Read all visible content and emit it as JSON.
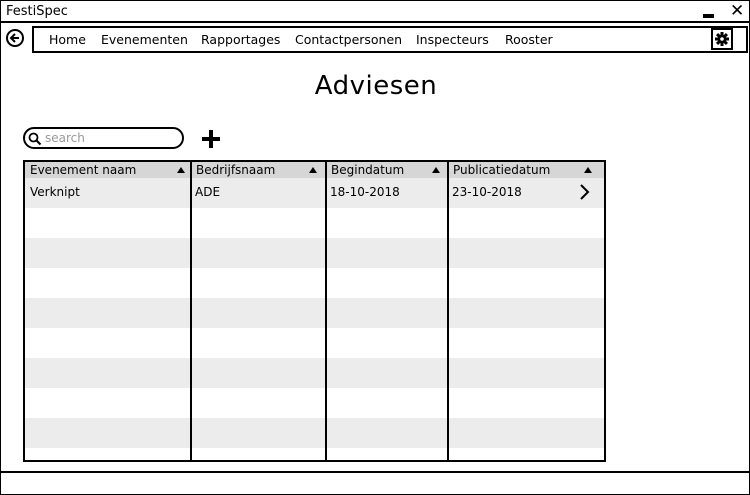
{
  "window": {
    "title": "FestiSpec",
    "controls": {
      "minimize_icon": "minimize-icon",
      "close_icon": "close-icon",
      "close_glyph": "✕"
    }
  },
  "nav": {
    "back_icon": "back-arrow-icon",
    "items": [
      {
        "label": "Home"
      },
      {
        "label": "Evenementen"
      },
      {
        "label": "Rapportages"
      },
      {
        "label": "Contactpersonen"
      },
      {
        "label": "Inspecteurs"
      },
      {
        "label": "Rooster"
      }
    ],
    "settings_icon": "gear-icon"
  },
  "page": {
    "title": "Adviesen"
  },
  "search": {
    "placeholder": "search",
    "value": "",
    "icon": "search-icon"
  },
  "add_button": {
    "icon": "plus-icon"
  },
  "table": {
    "columns": [
      {
        "label": "Evenement naam",
        "sort": "ascending"
      },
      {
        "label": "Bedrijfsnaam",
        "sort": "ascending"
      },
      {
        "label": "Begindatum",
        "sort": "ascending"
      },
      {
        "label": "Publicatiedatum",
        "sort": "ascending"
      }
    ],
    "rows": [
      {
        "cells": [
          "Verknipt",
          "ADE",
          "18-10-2018",
          "23-10-2018"
        ],
        "action_icon": "chevron-right-icon"
      }
    ]
  },
  "colors": {
    "header_bg": "#d6d6d6",
    "row_alt_bg": "#ececec",
    "border": "#000000",
    "placeholder": "#999999"
  }
}
